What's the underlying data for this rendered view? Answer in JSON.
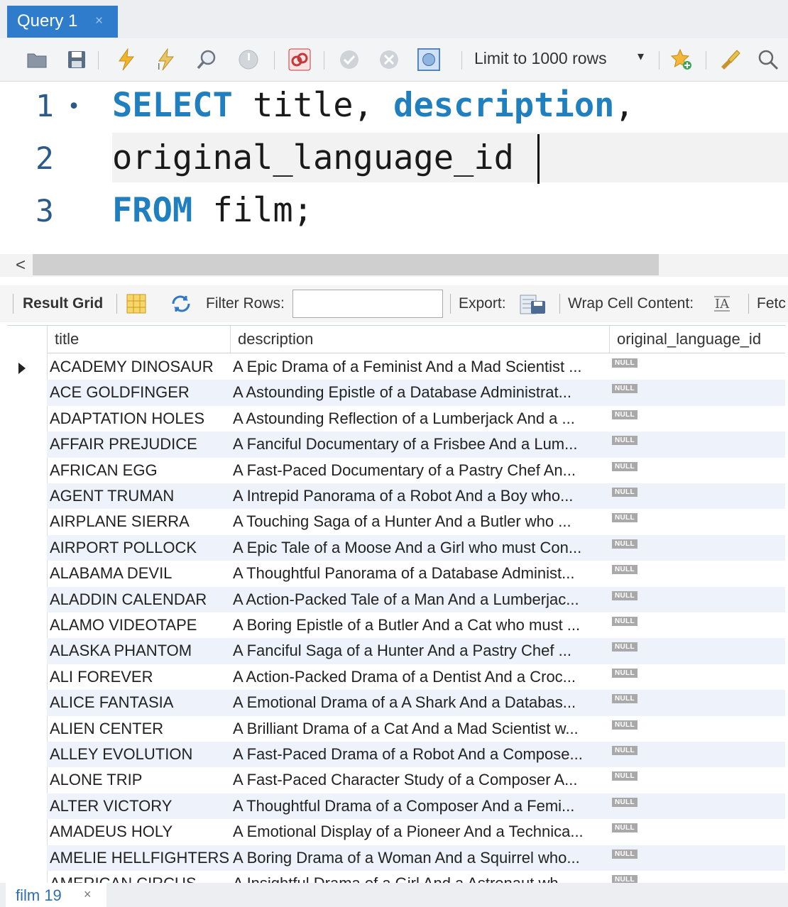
{
  "query_tab": {
    "label": "Query 1",
    "close": "×"
  },
  "toolbar": {
    "limit_label": "Limit to 1000 rows",
    "icons": [
      "folder-icon",
      "save-icon",
      "execute-icon",
      "execute-current-icon",
      "explain-icon",
      "stop-icon",
      "toggle-error-icon",
      "commit-icon",
      "rollback-icon",
      "autocommit-icon",
      "limit-dropdown",
      "add-favorite-icon",
      "beautify-icon",
      "search-icon"
    ]
  },
  "editor": {
    "lines": [
      {
        "num": "1",
        "marker": "•",
        "segments": [
          {
            "text": "SELECT",
            "kw": true
          },
          {
            "text": " title, ",
            "kw": false
          },
          {
            "text": "description",
            "kw": true
          },
          {
            "text": ",",
            "kw": false
          }
        ]
      },
      {
        "num": "2",
        "marker": "",
        "segments": [
          {
            "text": "original_language_id",
            "kw": false
          }
        ]
      },
      {
        "num": "3",
        "marker": "",
        "segments": [
          {
            "text": "FROM",
            "kw": true
          },
          {
            "text": " film;",
            "kw": false
          }
        ]
      }
    ]
  },
  "scroll_left": "<",
  "result_toolbar": {
    "result_grid": "Result Grid",
    "filter_rows": "Filter Rows:",
    "filter_value": "",
    "export": "Export:",
    "wrap": "Wrap Cell Content:",
    "fetch": "Fetc"
  },
  "grid": {
    "columns": [
      "title",
      "description",
      "original_language_id"
    ],
    "null_label": "NULL",
    "rows": [
      [
        "ACADEMY DINOSAUR",
        "A Epic Drama of a Feminist And a Mad Scientist ..."
      ],
      [
        "ACE GOLDFINGER",
        "A Astounding Epistle of a Database Administrat..."
      ],
      [
        "ADAPTATION HOLES",
        "A Astounding Reflection of a Lumberjack And a ..."
      ],
      [
        "AFFAIR PREJUDICE",
        "A Fanciful Documentary of a Frisbee And a Lum..."
      ],
      [
        "AFRICAN EGG",
        "A Fast-Paced Documentary of a Pastry Chef An..."
      ],
      [
        "AGENT TRUMAN",
        "A Intrepid Panorama of a Robot And a Boy who..."
      ],
      [
        "AIRPLANE SIERRA",
        "A Touching Saga of a Hunter And a Butler who ..."
      ],
      [
        "AIRPORT POLLOCK",
        "A Epic Tale of a Moose And a Girl who must Con..."
      ],
      [
        "ALABAMA DEVIL",
        "A Thoughtful Panorama of a Database Administ..."
      ],
      [
        "ALADDIN CALENDAR",
        "A Action-Packed Tale of a Man And a Lumberjac..."
      ],
      [
        "ALAMO VIDEOTAPE",
        "A Boring Epistle of a Butler And a Cat who must ..."
      ],
      [
        "ALASKA PHANTOM",
        "A Fanciful Saga of a Hunter And a Pastry Chef ..."
      ],
      [
        "ALI FOREVER",
        "A Action-Packed Drama of a Dentist And a Croc..."
      ],
      [
        "ALICE FANTASIA",
        "A Emotional Drama of a A Shark And a Databas..."
      ],
      [
        "ALIEN CENTER",
        "A Brilliant Drama of a Cat And a Mad Scientist w..."
      ],
      [
        "ALLEY EVOLUTION",
        "A Fast-Paced Drama of a Robot And a Compose..."
      ],
      [
        "ALONE TRIP",
        "A Fast-Paced Character Study of a Composer A..."
      ],
      [
        "ALTER VICTORY",
        "A Thoughtful Drama of a Composer And a Femi..."
      ],
      [
        "AMADEUS HOLY",
        "A Emotional Display of a Pioneer And a Technica..."
      ],
      [
        "AMELIE HELLFIGHTERS",
        "A Boring Drama of a Woman And a Squirrel who..."
      ],
      [
        "AMERICAN CIRCUS",
        "A Insightful Drama of a Girl And a Astronaut wh..."
      ]
    ]
  },
  "bottom_tab": {
    "label": "film 19",
    "close": "×"
  }
}
